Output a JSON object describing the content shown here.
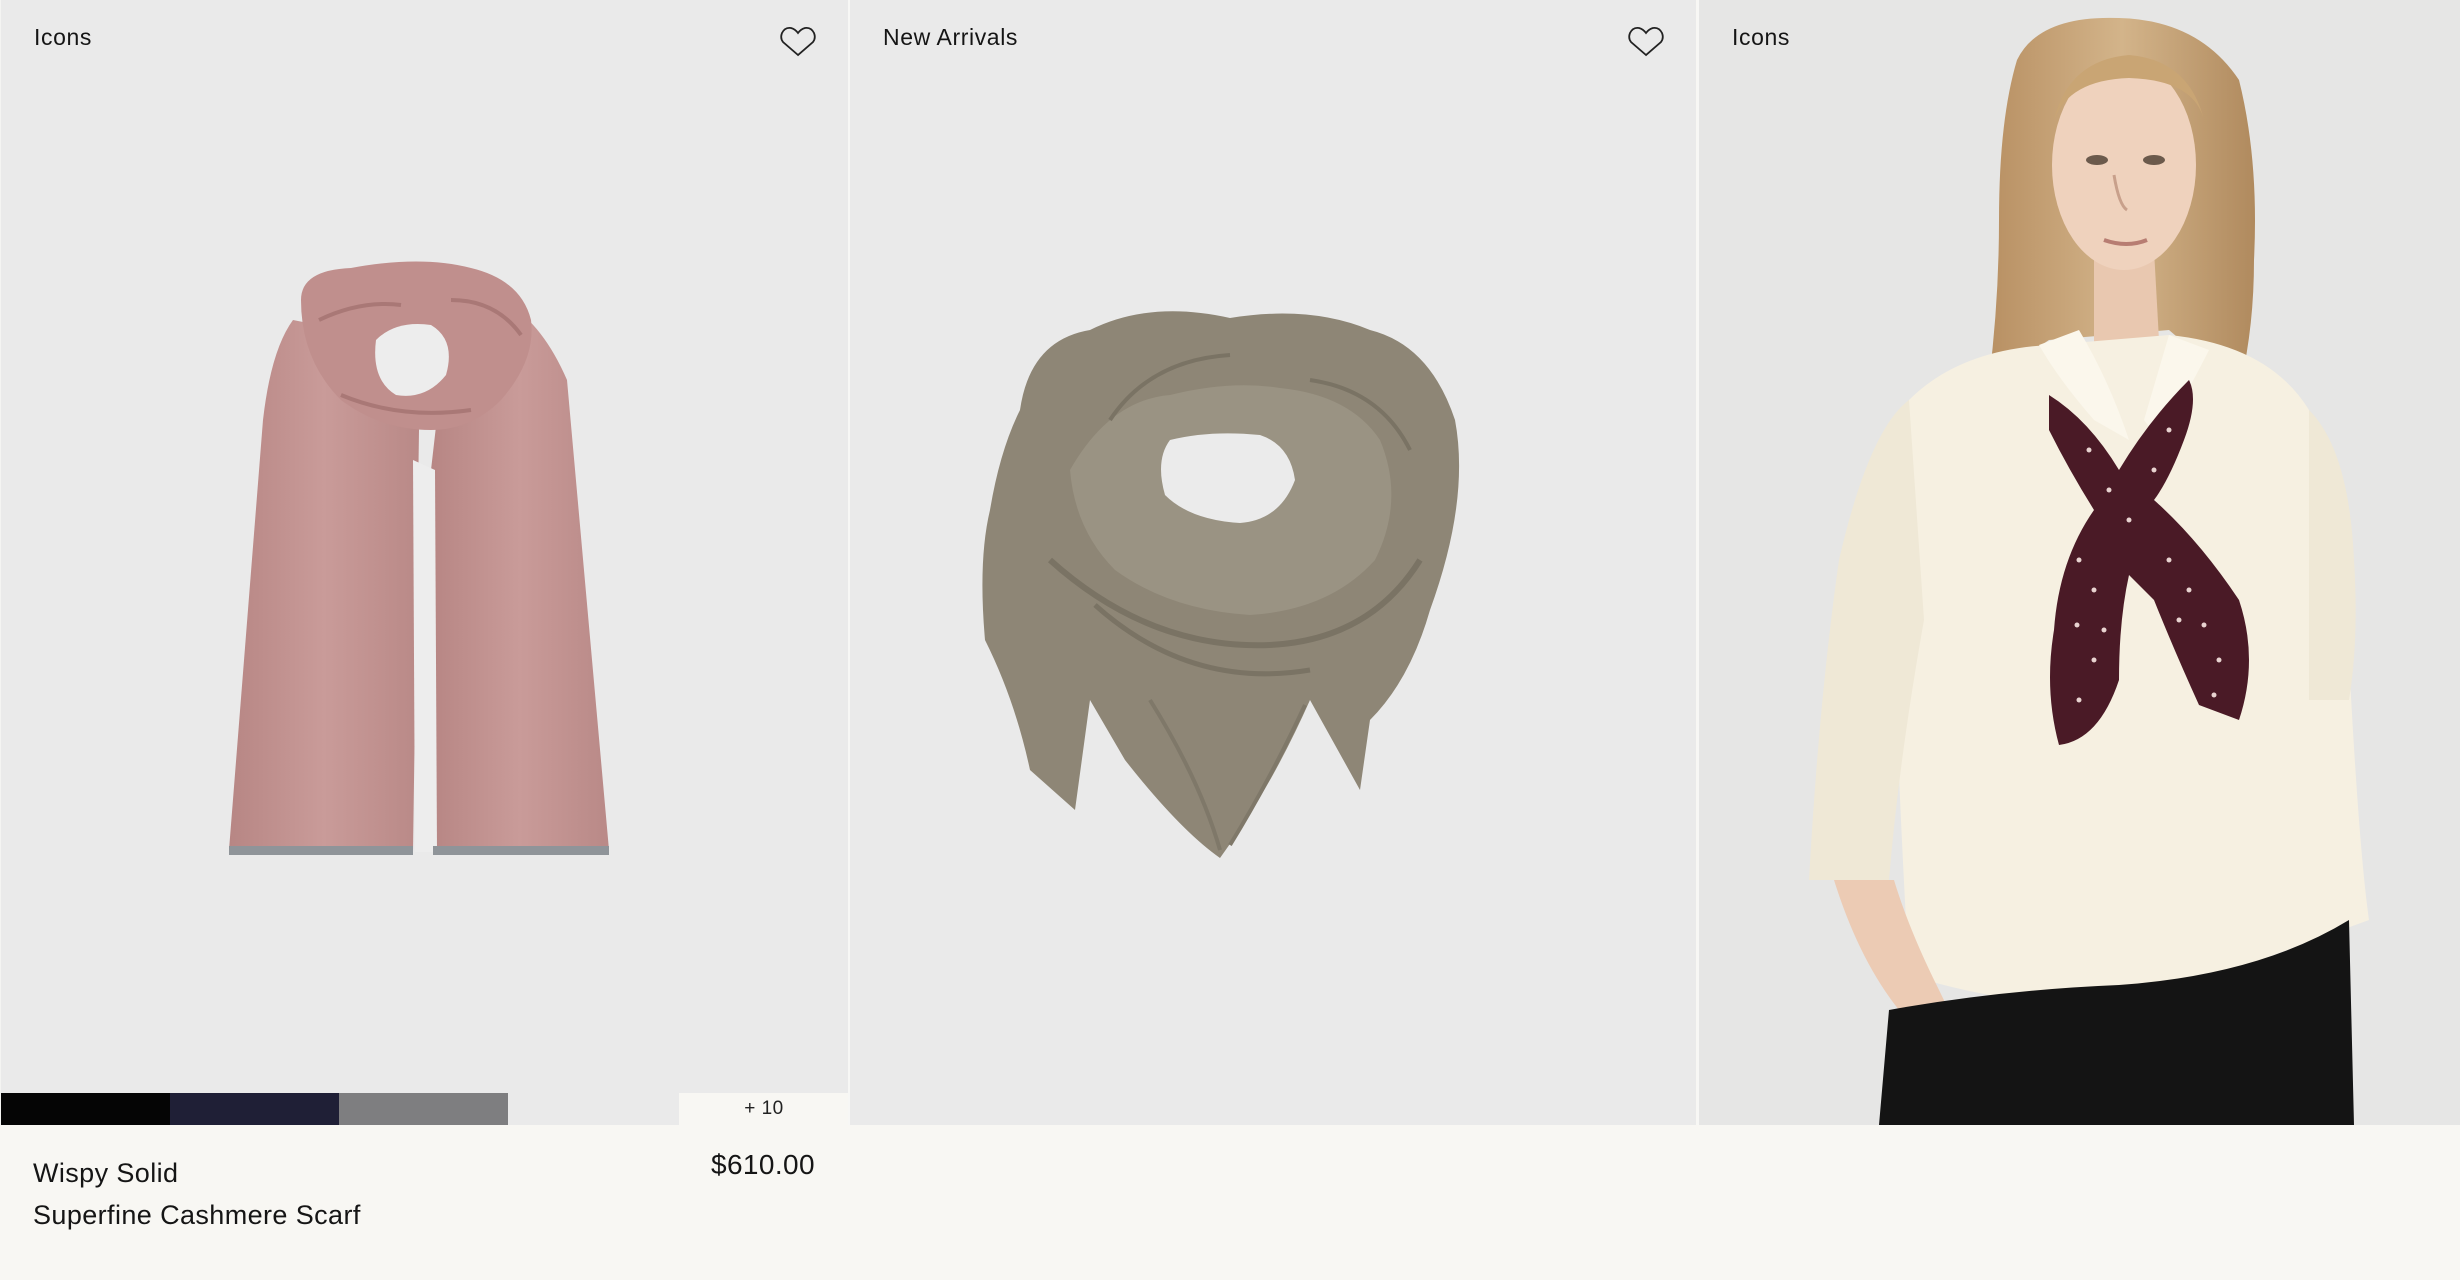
{
  "products": [
    {
      "tag": "Icons",
      "wishlist_icon": "heart-outline-icon",
      "image": "pink-scarf-flat",
      "swatches": [
        {
          "name": "black",
          "color": "#050505"
        },
        {
          "name": "navy",
          "color": "#1f1f36"
        },
        {
          "name": "grey",
          "color": "#7e7e80"
        }
      ],
      "more_colors": "+ 10",
      "name_line1": "Wispy Solid",
      "name_line2": "Superfine Cashmere Scarf",
      "price": "$610.00"
    },
    {
      "tag": "New Arrivals",
      "wishlist_icon": "heart-outline-icon",
      "image": "taupe-square-scarf"
    },
    {
      "tag": "Icons",
      "image": "model-with-neck-scarf"
    }
  ],
  "colors": {
    "page_background": "#f8f7f3",
    "image_background": "#eaeaea",
    "pink_scarf": "#c49593",
    "taupe_scarf": "#8e8676",
    "burgundy": "#4a1a26"
  }
}
